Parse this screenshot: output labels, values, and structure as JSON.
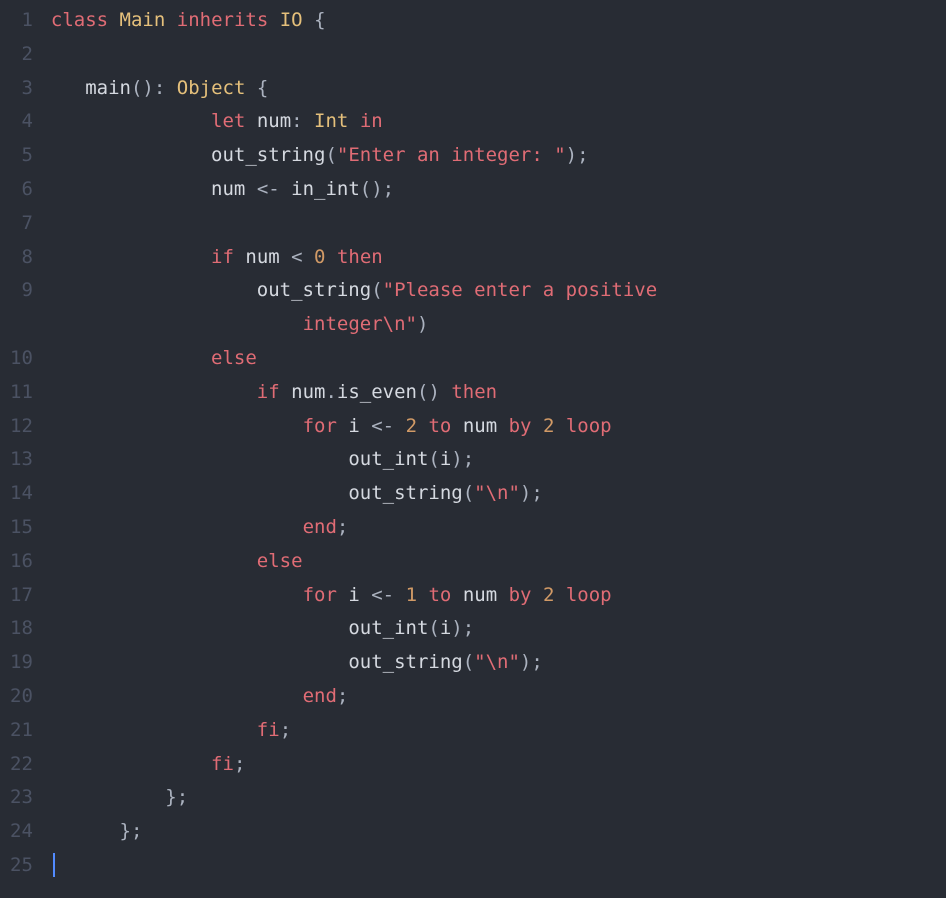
{
  "lines": [
    {
      "n": "1",
      "tokens": [
        {
          "t": "class",
          "c": "kw"
        },
        {
          "t": " ",
          "c": "punct"
        },
        {
          "t": "Main",
          "c": "type"
        },
        {
          "t": " ",
          "c": "punct"
        },
        {
          "t": "inherits",
          "c": "kw"
        },
        {
          "t": " ",
          "c": "punct"
        },
        {
          "t": "IO",
          "c": "type"
        },
        {
          "t": " {",
          "c": "punct"
        }
      ]
    },
    {
      "n": "2",
      "tokens": []
    },
    {
      "n": "3",
      "tokens": [
        {
          "t": "   ",
          "c": "punct"
        },
        {
          "t": "main",
          "c": "fn"
        },
        {
          "t": "(): ",
          "c": "punct"
        },
        {
          "t": "Object",
          "c": "type"
        },
        {
          "t": " {",
          "c": "punct"
        }
      ]
    },
    {
      "n": "4",
      "tokens": [
        {
          "t": "              ",
          "c": "punct"
        },
        {
          "t": "let",
          "c": "kw"
        },
        {
          "t": " ",
          "c": "punct"
        },
        {
          "t": "num",
          "c": "ident"
        },
        {
          "t": ": ",
          "c": "punct"
        },
        {
          "t": "Int",
          "c": "type"
        },
        {
          "t": " ",
          "c": "punct"
        },
        {
          "t": "in",
          "c": "kw"
        }
      ]
    },
    {
      "n": "5",
      "tokens": [
        {
          "t": "              ",
          "c": "punct"
        },
        {
          "t": "out_string",
          "c": "fn"
        },
        {
          "t": "(",
          "c": "punct"
        },
        {
          "t": "\"Enter an integer: \"",
          "c": "str"
        },
        {
          "t": ");",
          "c": "punct"
        }
      ]
    },
    {
      "n": "6",
      "tokens": [
        {
          "t": "              ",
          "c": "punct"
        },
        {
          "t": "num",
          "c": "ident"
        },
        {
          "t": " <- ",
          "c": "op"
        },
        {
          "t": "in_int",
          "c": "fn"
        },
        {
          "t": "();",
          "c": "punct"
        }
      ]
    },
    {
      "n": "7",
      "tokens": []
    },
    {
      "n": "8",
      "tokens": [
        {
          "t": "              ",
          "c": "punct"
        },
        {
          "t": "if",
          "c": "kw"
        },
        {
          "t": " ",
          "c": "punct"
        },
        {
          "t": "num",
          "c": "ident"
        },
        {
          "t": " < ",
          "c": "op"
        },
        {
          "t": "0",
          "c": "num"
        },
        {
          "t": " ",
          "c": "punct"
        },
        {
          "t": "then",
          "c": "kw"
        }
      ]
    },
    {
      "n": "9",
      "tokens": [
        {
          "t": "                  ",
          "c": "punct"
        },
        {
          "t": "out_string",
          "c": "fn"
        },
        {
          "t": "(",
          "c": "punct"
        },
        {
          "t": "\"Please enter a positive ",
          "c": "str"
        }
      ]
    },
    {
      "n": "9b",
      "tokens": [
        {
          "t": "                      ",
          "c": "punct"
        },
        {
          "t": "integer\\n\"",
          "c": "str"
        },
        {
          "t": ")",
          "c": "punct"
        }
      ]
    },
    {
      "n": "10",
      "tokens": [
        {
          "t": "              ",
          "c": "punct"
        },
        {
          "t": "else",
          "c": "kw"
        }
      ]
    },
    {
      "n": "11",
      "tokens": [
        {
          "t": "                  ",
          "c": "punct"
        },
        {
          "t": "if",
          "c": "kw"
        },
        {
          "t": " ",
          "c": "punct"
        },
        {
          "t": "num",
          "c": "ident"
        },
        {
          "t": ".",
          "c": "punct"
        },
        {
          "t": "is_even",
          "c": "fn"
        },
        {
          "t": "() ",
          "c": "punct"
        },
        {
          "t": "then",
          "c": "kw"
        }
      ]
    },
    {
      "n": "12",
      "tokens": [
        {
          "t": "                      ",
          "c": "punct"
        },
        {
          "t": "for",
          "c": "kw"
        },
        {
          "t": " ",
          "c": "punct"
        },
        {
          "t": "i",
          "c": "ident"
        },
        {
          "t": " <- ",
          "c": "op"
        },
        {
          "t": "2",
          "c": "num"
        },
        {
          "t": " ",
          "c": "punct"
        },
        {
          "t": "to",
          "c": "kw"
        },
        {
          "t": " ",
          "c": "punct"
        },
        {
          "t": "num",
          "c": "ident"
        },
        {
          "t": " ",
          "c": "punct"
        },
        {
          "t": "by",
          "c": "kw"
        },
        {
          "t": " ",
          "c": "punct"
        },
        {
          "t": "2",
          "c": "num"
        },
        {
          "t": " ",
          "c": "punct"
        },
        {
          "t": "loop",
          "c": "kw"
        }
      ]
    },
    {
      "n": "13",
      "tokens": [
        {
          "t": "                          ",
          "c": "punct"
        },
        {
          "t": "out_int",
          "c": "fn"
        },
        {
          "t": "(",
          "c": "punct"
        },
        {
          "t": "i",
          "c": "ident"
        },
        {
          "t": ");",
          "c": "punct"
        }
      ]
    },
    {
      "n": "14",
      "tokens": [
        {
          "t": "                          ",
          "c": "punct"
        },
        {
          "t": "out_string",
          "c": "fn"
        },
        {
          "t": "(",
          "c": "punct"
        },
        {
          "t": "\"\\n\"",
          "c": "str"
        },
        {
          "t": ");",
          "c": "punct"
        }
      ]
    },
    {
      "n": "15",
      "tokens": [
        {
          "t": "                      ",
          "c": "punct"
        },
        {
          "t": "end",
          "c": "kw"
        },
        {
          "t": ";",
          "c": "punct"
        }
      ]
    },
    {
      "n": "16",
      "tokens": [
        {
          "t": "                  ",
          "c": "punct"
        },
        {
          "t": "else",
          "c": "kw"
        }
      ]
    },
    {
      "n": "17",
      "tokens": [
        {
          "t": "                      ",
          "c": "punct"
        },
        {
          "t": "for",
          "c": "kw"
        },
        {
          "t": " ",
          "c": "punct"
        },
        {
          "t": "i",
          "c": "ident"
        },
        {
          "t": " <- ",
          "c": "op"
        },
        {
          "t": "1",
          "c": "num"
        },
        {
          "t": " ",
          "c": "punct"
        },
        {
          "t": "to",
          "c": "kw"
        },
        {
          "t": " ",
          "c": "punct"
        },
        {
          "t": "num",
          "c": "ident"
        },
        {
          "t": " ",
          "c": "punct"
        },
        {
          "t": "by",
          "c": "kw"
        },
        {
          "t": " ",
          "c": "punct"
        },
        {
          "t": "2",
          "c": "num"
        },
        {
          "t": " ",
          "c": "punct"
        },
        {
          "t": "loop",
          "c": "kw"
        }
      ]
    },
    {
      "n": "18",
      "tokens": [
        {
          "t": "                          ",
          "c": "punct"
        },
        {
          "t": "out_int",
          "c": "fn"
        },
        {
          "t": "(",
          "c": "punct"
        },
        {
          "t": "i",
          "c": "ident"
        },
        {
          "t": ");",
          "c": "punct"
        }
      ]
    },
    {
      "n": "19",
      "tokens": [
        {
          "t": "                          ",
          "c": "punct"
        },
        {
          "t": "out_string",
          "c": "fn"
        },
        {
          "t": "(",
          "c": "punct"
        },
        {
          "t": "\"\\n\"",
          "c": "str"
        },
        {
          "t": ");",
          "c": "punct"
        }
      ]
    },
    {
      "n": "20",
      "tokens": [
        {
          "t": "                      ",
          "c": "punct"
        },
        {
          "t": "end",
          "c": "kw"
        },
        {
          "t": ";",
          "c": "punct"
        }
      ]
    },
    {
      "n": "21",
      "tokens": [
        {
          "t": "                  ",
          "c": "punct"
        },
        {
          "t": "fi",
          "c": "kw"
        },
        {
          "t": ";",
          "c": "punct"
        }
      ]
    },
    {
      "n": "22",
      "tokens": [
        {
          "t": "              ",
          "c": "punct"
        },
        {
          "t": "fi",
          "c": "kw"
        },
        {
          "t": ";",
          "c": "punct"
        }
      ]
    },
    {
      "n": "23",
      "tokens": [
        {
          "t": "          };",
          "c": "punct"
        }
      ]
    },
    {
      "n": "24",
      "tokens": [
        {
          "t": "      };",
          "c": "punct"
        }
      ]
    },
    {
      "n": "25",
      "tokens": [],
      "cursor": true
    }
  ]
}
